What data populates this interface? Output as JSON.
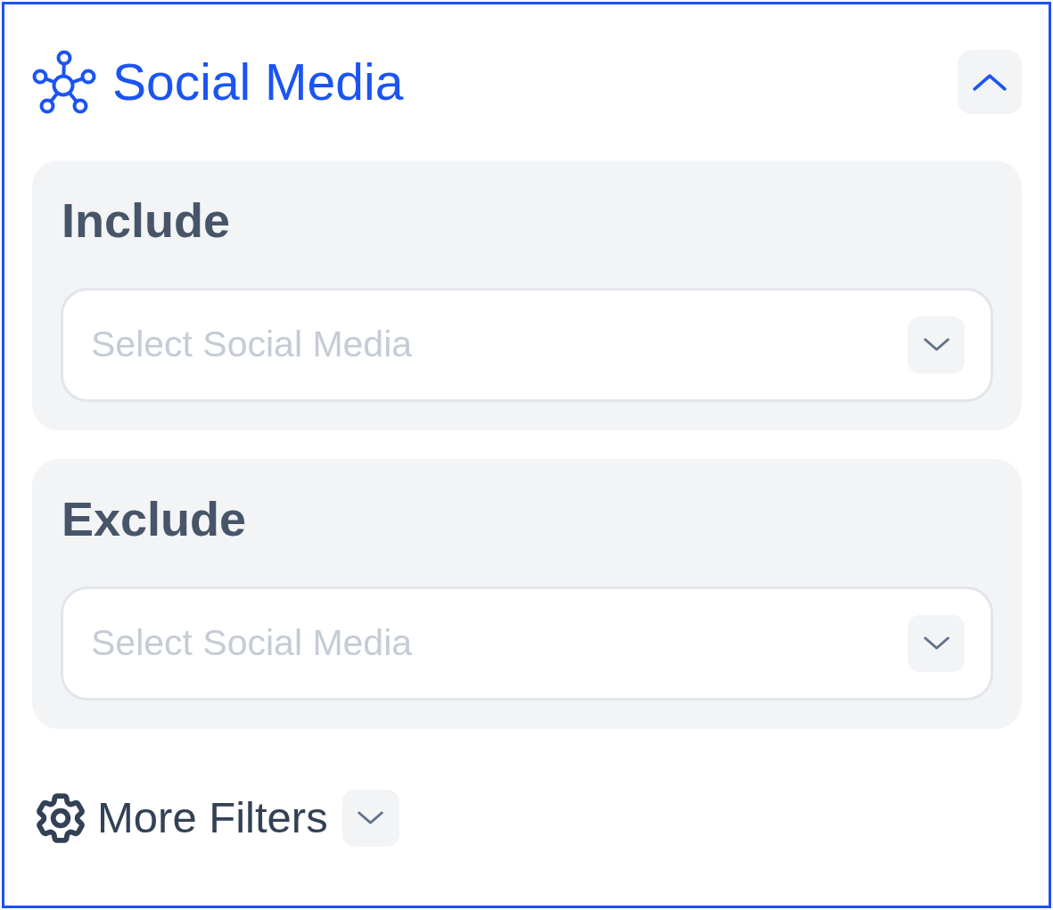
{
  "header": {
    "title": "Social Media",
    "expanded": true
  },
  "sections": [
    {
      "label": "Include",
      "select": {
        "placeholder": "Select Social Media",
        "expanded": false
      }
    },
    {
      "label": "Exclude",
      "select": {
        "placeholder": "Select Social Media",
        "expanded": false
      }
    }
  ],
  "more_filters": {
    "label": "More Filters",
    "expanded": false
  }
}
